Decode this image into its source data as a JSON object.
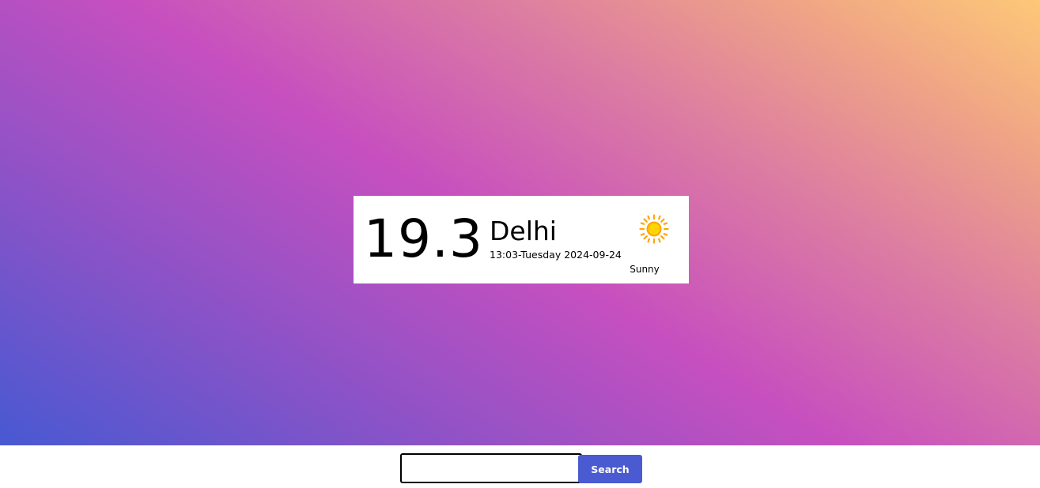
{
  "weather": {
    "temperature": "19.3",
    "city": "Delhi",
    "datetime": "13:03-Tuesday 2024-09-24",
    "condition": "Sunny",
    "icon": "sun-icon"
  },
  "search": {
    "value": "",
    "placeholder": "",
    "button_label": "Search"
  },
  "colors": {
    "gradient": [
      "#4759d2",
      "#8553c8",
      "#c74fbf",
      "#dd7fa0",
      "#f0a585",
      "#fdc878"
    ],
    "button": "#4a5bd1",
    "sun": "#ffd000",
    "sun_outline": "#ffa500"
  }
}
